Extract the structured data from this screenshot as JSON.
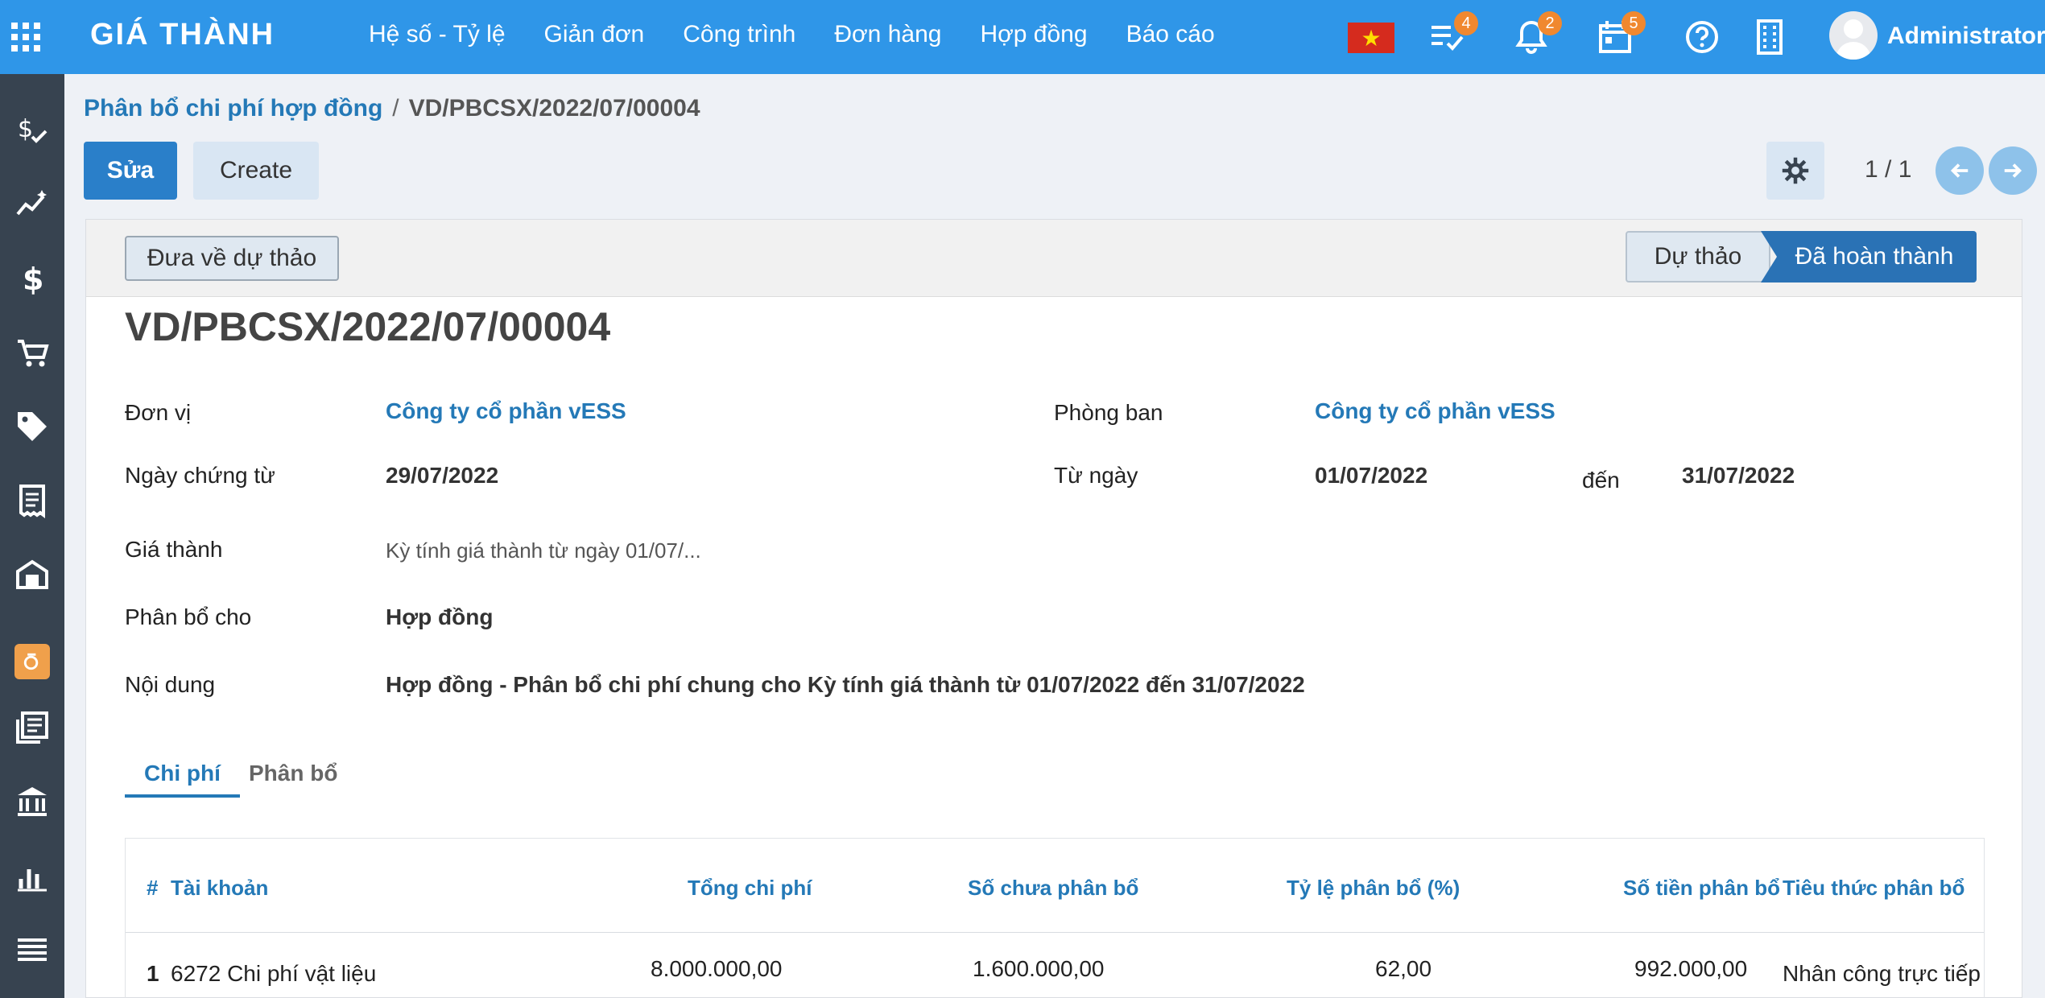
{
  "topbar": {
    "brand": "GIÁ THÀNH",
    "menu": [
      "Hệ số - Tỷ lệ",
      "Giản đơn",
      "Công trình",
      "Đơn hàng",
      "Hợp đồng",
      "Báo cáo"
    ],
    "activities_badge": "4",
    "notifications_badge": "2",
    "calendar_badge": "5",
    "user": "Administrator"
  },
  "breadcrumb": {
    "parent": "Phân bổ chi phí hợp đồng",
    "separator": "/",
    "current": "VD/PBCSX/2022/07/00004"
  },
  "actions": {
    "edit": "Sửa",
    "create": "Create",
    "pager": "1 / 1"
  },
  "statusbar": {
    "reset_to_draft": "Đưa về dự thảo",
    "stages": [
      "Dự thảo",
      "Đã hoàn thành"
    ],
    "active_stage": "Đã hoàn thành"
  },
  "form": {
    "title": "VD/PBCSX/2022/07/00004",
    "don_vi_label": "Đơn vị",
    "don_vi_value": "Công ty cổ phần vESS",
    "phong_ban_label": "Phòng ban",
    "phong_ban_value": "Công ty cổ phần vESS",
    "ngay_chung_tu_label": "Ngày chứng từ",
    "ngay_chung_tu_value": "29/07/2022",
    "tu_ngay_label": "Từ ngày",
    "tu_ngay_value": "01/07/2022",
    "den_label": "đến",
    "den_value": "31/07/2022",
    "gia_thanh_label": "Giá thành",
    "gia_thanh_value": "Kỳ tính giá thành từ ngày 01/07/...",
    "phan_bo_cho_label": "Phân bổ cho",
    "phan_bo_cho_value": "Hợp đồng",
    "noi_dung_label": "Nội dung",
    "noi_dung_value": "Hợp đồng - Phân bổ chi phí chung cho Kỳ tính giá thành từ 01/07/2022 đến 31/07/2022"
  },
  "tabs": [
    "Chi phí",
    "Phân bổ"
  ],
  "table": {
    "headers": {
      "index": "#",
      "account": "Tài khoản",
      "total": "Tổng chi phí",
      "unallocated": "Số chưa phân bổ",
      "ratio": "Tỷ lệ phân bổ (%)",
      "allocated": "Số tiền phân bổ",
      "criteria": "Tiêu thức phân bổ"
    },
    "rows": [
      {
        "index": "1",
        "account": "6272 Chi phí vật liệu",
        "total": "8.000.000,00",
        "unallocated": "1.600.000,00",
        "ratio": "62,00",
        "allocated": "992.000,00",
        "criteria": "Nhân công trực tiếp"
      }
    ]
  },
  "colors": {
    "topbar": "#2f96e8",
    "sidebar": "#374350",
    "primary": "#2a7fc9",
    "link": "#2479b7",
    "badge": "#f0882f"
  }
}
